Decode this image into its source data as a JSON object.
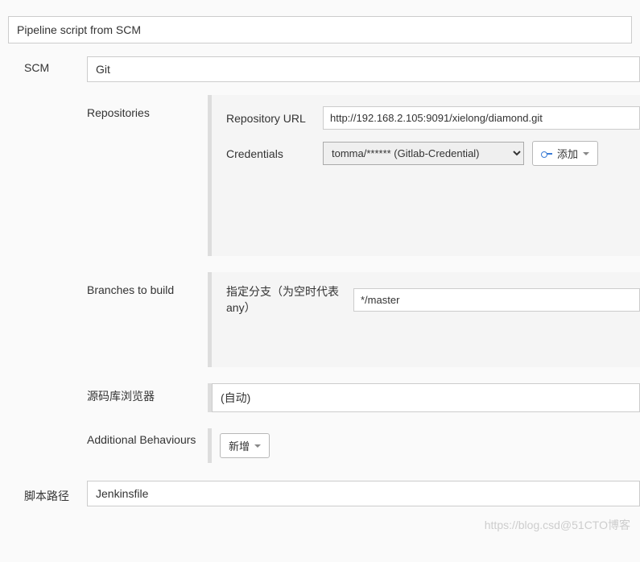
{
  "definition": {
    "selected": "Pipeline script from SCM"
  },
  "scm": {
    "label": "SCM",
    "selected": "Git",
    "repositories": {
      "title": "Repositories",
      "repo_url_label": "Repository URL",
      "repo_url_value": "http://192.168.2.105:9091/xielong/diamond.git",
      "credentials_label": "Credentials",
      "credentials_selected": "tomma/****** (Gitlab-Credential)",
      "add_button": "添加"
    },
    "branches": {
      "title": "Branches to build",
      "specifier_label": "指定分支（为空时代表any）",
      "specifier_value": "*/master"
    },
    "browser": {
      "label": "源码库浏览器",
      "selected": "(自动)"
    },
    "additional": {
      "label": "Additional Behaviours",
      "add_button": "新增"
    }
  },
  "script_path": {
    "label": "脚本路径",
    "value": "Jenkinsfile"
  },
  "watermark": "https://blog.csd@51CTO博客"
}
